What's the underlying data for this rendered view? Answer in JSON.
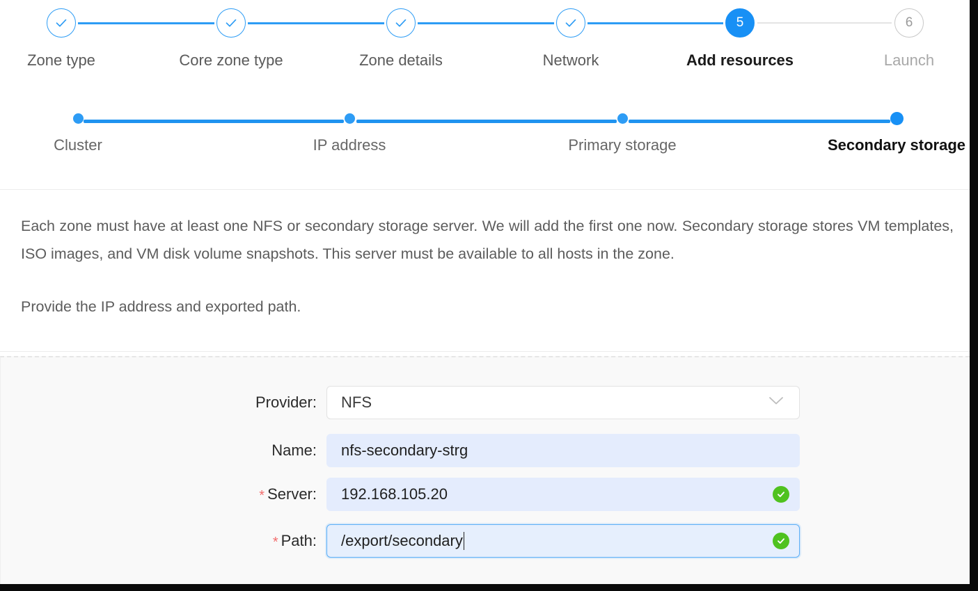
{
  "wizard": {
    "main_steps": [
      {
        "label": "Zone type",
        "state": "done",
        "marker": "check"
      },
      {
        "label": "Core zone type",
        "state": "done",
        "marker": "check"
      },
      {
        "label": "Zone details",
        "state": "done",
        "marker": "check"
      },
      {
        "label": "Network",
        "state": "done",
        "marker": "check"
      },
      {
        "label": "Add resources",
        "state": "current",
        "marker": "5"
      },
      {
        "label": "Launch",
        "state": "todo",
        "marker": "6"
      }
    ],
    "sub_steps": [
      {
        "label": "Cluster",
        "state": "done"
      },
      {
        "label": "IP address",
        "state": "done"
      },
      {
        "label": "Primary storage",
        "state": "done"
      },
      {
        "label": "Secondary storage",
        "state": "current"
      }
    ]
  },
  "description": {
    "paragraph1": "Each zone must have at least one NFS or secondary storage server. We will add the first one now. Secondary storage stores VM templates, ISO images, and VM disk volume snapshots. This server must be available to all hosts in the zone.",
    "paragraph2": "Provide the IP address and exported path."
  },
  "form": {
    "provider": {
      "label": "Provider:",
      "value": "NFS",
      "required": false,
      "control": "select",
      "options": [
        "NFS"
      ]
    },
    "name": {
      "label": "Name:",
      "value": "nfs-secondary-strg",
      "placeholder": "",
      "required": false,
      "control": "input"
    },
    "server": {
      "label": "Server:",
      "value": "192.168.105.20",
      "placeholder": "",
      "required": true,
      "required_marker": "*",
      "control": "input",
      "validation": "valid"
    },
    "path": {
      "label": "Path:",
      "value": "/export/secondary",
      "placeholder": "",
      "required": true,
      "required_marker": "*",
      "control": "input",
      "validation": "valid",
      "focused": true
    }
  },
  "colors": {
    "accent_blue": "#1890f5",
    "step_line_blue": "#2d9cf5",
    "inactive_gray": "#e4e4e4",
    "success_green": "#4fc21f",
    "required_red": "#f26d6d",
    "autofill_blue": "#e4ecfd",
    "panel_gray": "#f9f9f9"
  }
}
